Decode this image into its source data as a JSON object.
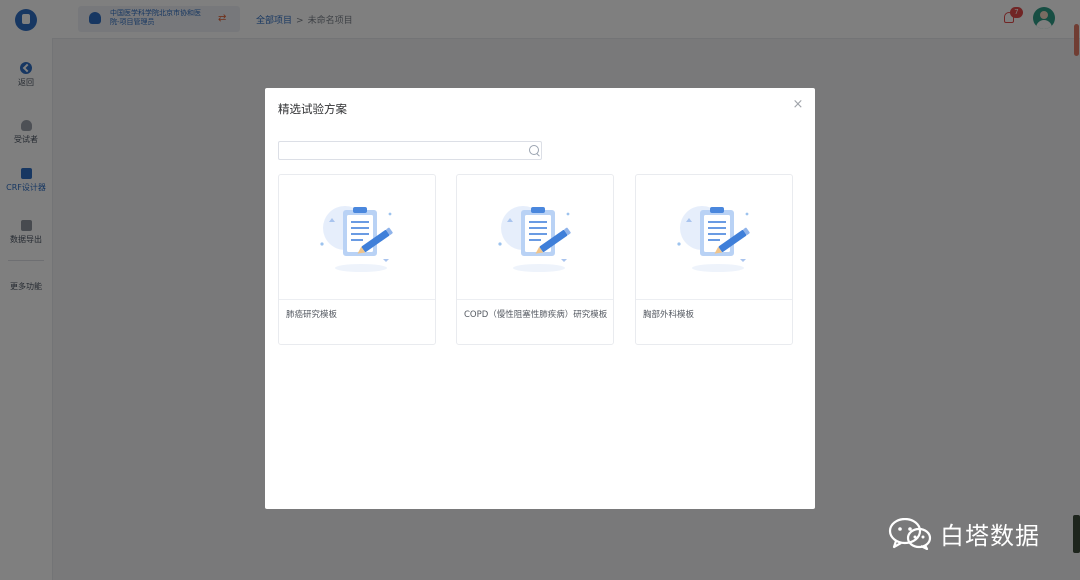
{
  "sidebar": {
    "items": [
      {
        "label": "返回",
        "icon": "back-icon"
      },
      {
        "label": "受试者",
        "icon": "user-icon"
      },
      {
        "label": "CRF设计器",
        "icon": "document-icon"
      },
      {
        "label": "数据导出",
        "icon": "folder-icon"
      },
      {
        "label": "更多功能",
        "icon": ""
      }
    ],
    "active_color": "#2f6fc4"
  },
  "header": {
    "org_name": "中国医学科学院北京市协和医院-项目管理员",
    "breadcrumb": [
      "全部项目",
      "未命名项目"
    ],
    "breadcrumb_separator": ">",
    "notification_count": "7"
  },
  "modal": {
    "title": "精选试验方案",
    "close_glyph": "×",
    "search": {
      "value": "",
      "placeholder": ""
    },
    "templates": [
      {
        "label": "肺癌研究模板"
      },
      {
        "label": "COPD（慢性阻塞性肺疾病）研究模板"
      },
      {
        "label": "胸部外科模板"
      }
    ]
  },
  "watermark": {
    "text": "白塔数据"
  },
  "colors": {
    "primary": "#2f6fc4",
    "danger": "#e24b4b",
    "overlay": "rgba(0,0,0,0.5)"
  }
}
